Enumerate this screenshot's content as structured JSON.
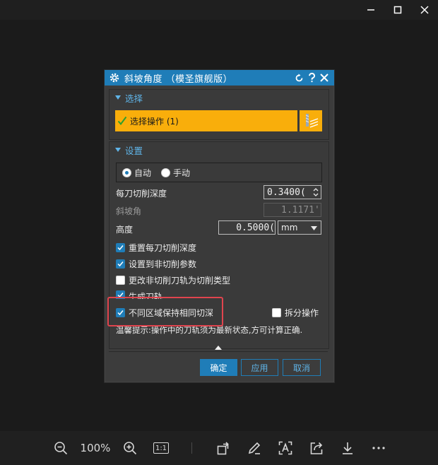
{
  "dialog": {
    "title": "斜坡角度 （模圣旗舰版）",
    "section_select": "选择",
    "select_button": "选择操作 (1)",
    "section_settings": "设置",
    "radio_auto": "自动",
    "radio_manual": "手动",
    "depth_label": "每刀切削深度",
    "depth_value": "0.3400(",
    "angle_label": "斜坡角",
    "angle_value": "1.1171'",
    "height_label": "高度",
    "height_value": "0.5000(",
    "unit": "mm",
    "checks": [
      {
        "label": "重置每刀切削深度",
        "checked": true
      },
      {
        "label": "设置到非切削参数",
        "checked": true
      },
      {
        "label": "更改非切削刀轨为切削类型",
        "checked": false
      },
      {
        "label": "生成刀轨",
        "checked": true
      },
      {
        "label": "不同区域保持相同切深",
        "checked": true
      }
    ],
    "split_label": "拆分操作",
    "tip": "温馨提示:操作中的刀轨须为最新状态,方可计算正确.",
    "ok": "确定",
    "apply": "应用",
    "cancel": "取消"
  },
  "viewer": {
    "zoom": "100%",
    "actual_size": "1:1"
  },
  "colors": {
    "accent": "#1f7db8",
    "selection": "#f9ae0b",
    "highlight": "#e0444e"
  }
}
